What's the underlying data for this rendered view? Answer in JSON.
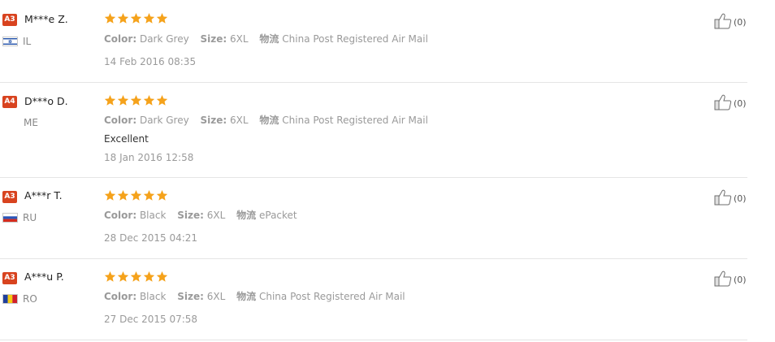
{
  "colors": {
    "star": "#f5a21b",
    "badge": "#d8431f",
    "divider": "#e5e5e5"
  },
  "labels": {
    "color": "Color:",
    "size": "Size:",
    "shipping": "物流"
  },
  "reviews": [
    {
      "level": "A3",
      "name": "M***e Z.",
      "country": "IL",
      "flag": "israel-flag-icon",
      "rating": 5,
      "color": "Dark Grey",
      "size": "6XL",
      "shipping": "China Post Registered Air Mail",
      "text": "",
      "date": "14 Feb 2016 08:35",
      "helpful": "(0)"
    },
    {
      "level": "A4",
      "name": "D***o D.",
      "country": "ME",
      "flag": "",
      "rating": 5,
      "color": "Dark Grey",
      "size": "6XL",
      "shipping": "China Post Registered Air Mail",
      "text": "Excellent",
      "date": "18 Jan 2016 12:58",
      "helpful": "(0)"
    },
    {
      "level": "A3",
      "name": "A***r T.",
      "country": "RU",
      "flag": "russia-flag-icon",
      "rating": 5,
      "color": "Black",
      "size": "6XL",
      "shipping": "ePacket",
      "text": "",
      "date": "28 Dec 2015 04:21",
      "helpful": "(0)"
    },
    {
      "level": "A3",
      "name": "A***u P.",
      "country": "RO",
      "flag": "romania-flag-icon",
      "rating": 5,
      "color": "Black",
      "size": "6XL",
      "shipping": "China Post Registered Air Mail",
      "text": "",
      "date": "27 Dec 2015 07:58",
      "helpful": "(0)"
    }
  ]
}
